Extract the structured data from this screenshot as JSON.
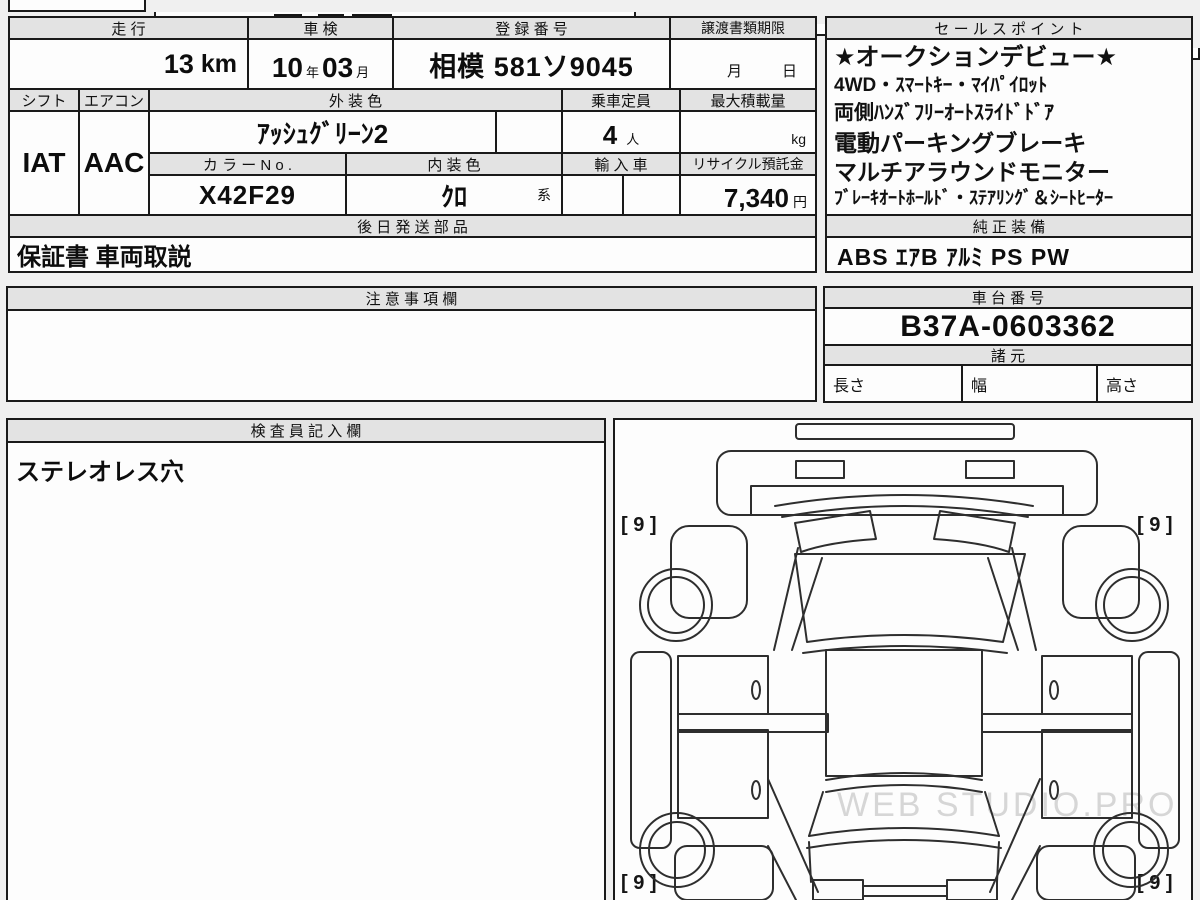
{
  "sheet": {
    "row1": {
      "mileage_label": "走 行",
      "mileage_value": "13",
      "mileage_unit": "km",
      "inspection_label": "車 検",
      "inspection_year": "10",
      "inspection_year_suffix": "年",
      "inspection_month": "03",
      "inspection_month_suffix": "月",
      "registration_label": "登 録 番 号",
      "registration_value": "相模 581ソ9045",
      "deadline_label": "譲渡書類期限",
      "deadline_month": "月",
      "deadline_day": "日"
    },
    "row2": {
      "shift_label": "シフト",
      "shift_value": "IAT",
      "aircon_label": "エアコン",
      "aircon_value": "AAC",
      "exterior_color_label": "外 装 色",
      "exterior_color_value": "ｱｯｼｭｸﾞﾘｰﾝ2",
      "capacity_label": "乗車定員",
      "capacity_value": "4",
      "capacity_unit": "人",
      "max_load_label": "最大積載量",
      "max_load_unit": "kg"
    },
    "row3": {
      "color_no_label": "カ ラ ー N o .",
      "color_no_value": "X42F29",
      "interior_color_label": "内 装 色",
      "interior_color_value": "ｸﾛ",
      "interior_color_suffix": "系",
      "import_label": "輸 入 車",
      "recycle_label": "リサイクル預託金",
      "recycle_value": "7,340",
      "recycle_unit": "円"
    },
    "later_parts": {
      "label": "後 日 発 送 部 品",
      "value": "保証書 車両取説"
    },
    "genuine": {
      "label": "純 正 装 備",
      "value": "ABS ｴｱB ｱﾙﾐ PS PW"
    },
    "sales": {
      "label": "セ ー ル ス ポ イ ン ト",
      "lines": [
        "★オークションデビュー★",
        "4WD・ｽﾏｰﾄｷｰ・ﾏｲﾊﾟｲﾛｯﾄ",
        "両側ﾊﾝｽﾞﾌﾘｰｵｰﾄｽﾗｲﾄﾞﾄﾞｱ",
        "電動パーキングブレーキ",
        "マルチアラウンドモニター",
        "ﾌﾞﾚｰｷｵｰﾄﾎｰﾙﾄﾞ・ｽﾃｱﾘﾝｸﾞ＆ｼｰﾄﾋｰﾀｰ"
      ]
    },
    "notes": {
      "label": "注 意 事 項 欄",
      "value": ""
    },
    "chassis": {
      "label": "車 台 番 号",
      "value": "B37A-0603362"
    },
    "dimensions": {
      "label": "諸 元",
      "length_label": "長さ",
      "length_value": "",
      "width_label": "幅",
      "width_value": "",
      "height_label": "高さ",
      "height_value": ""
    },
    "inspector": {
      "label": "検 査 員 記 入 欄",
      "value": "ステレオレス穴"
    },
    "diagram": {
      "corner_marks": [
        "[ 9 ]",
        "[ 9 ]",
        "[ 9 ]",
        "[ 9 ]"
      ],
      "watermark": "WEB STUDIO.PRO"
    },
    "colors": {
      "border": "#1a1a1a",
      "header_bg": "#e3e3e3",
      "page_bg": "#f0f0f0",
      "cell_bg": "#fdfdfd"
    }
  }
}
